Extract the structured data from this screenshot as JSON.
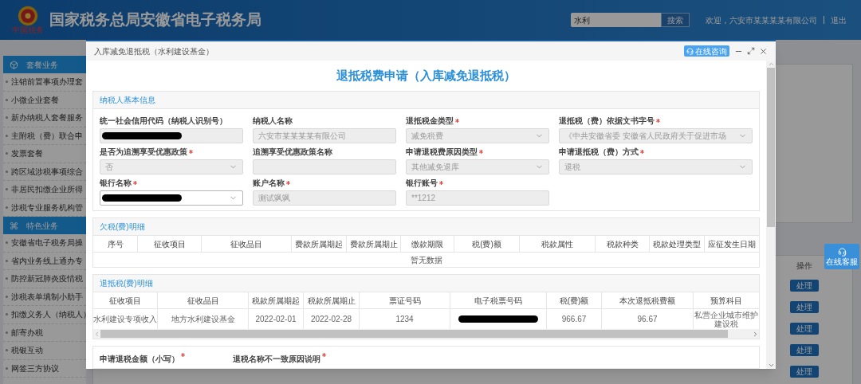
{
  "header": {
    "title": "国家税务总局安徽省电子税务局",
    "logo_text": "中国税务",
    "search": {
      "value": "水利"
    },
    "search_button": "搜索",
    "welcome": "欢迎，六安市某某某某有限公司",
    "logout": "退出"
  },
  "sidebar": [
    {
      "title": "套餐业务",
      "kind": "package",
      "items": [
        "注销前置事项办理套",
        "小微企业套餐",
        "新办纳税人套餐服务",
        "主附税（费）联合申",
        "发票套餐",
        "跨区域涉税事项综合",
        "非居民扣缴企业所得",
        "涉税专业服务机构管"
      ]
    },
    {
      "title": "特色业务",
      "kind": "feature",
      "items": [
        "安徽省电子税务局操",
        "省内业务线上通办专",
        "防控新冠肺炎疫情税",
        "涉税表单填制小助手",
        "扣缴义务人（纳税人）",
        "邮寄办税",
        "税银互动",
        "网签三方协议"
      ]
    }
  ],
  "background_table": {
    "column": "操作",
    "buttons": [
      "处理",
      "处理",
      "处理",
      "处理",
      "处理"
    ]
  },
  "float_service": "在线客服",
  "modal": {
    "title": "入库减免退抵税（水利建设基金）",
    "consult_button": "在线咨询",
    "heading": "退抵税费申请（入库减免退抵税）",
    "basic_info": {
      "title": "纳税人基本信息",
      "fields": [
        {
          "label": "统一社会信用代码（纳税人识别号）",
          "required": false,
          "kind": "input",
          "redacted": true,
          "disabled": true
        },
        {
          "label": "纳税人名称",
          "required": false,
          "kind": "input",
          "value": "六安市某某某某有限公司",
          "redacted": false,
          "disabled": true
        },
        {
          "label": "退抵税金类型",
          "required": true,
          "kind": "select",
          "value": "减免税费",
          "redacted": false,
          "disabled": true
        },
        {
          "label": "退抵税（费）依据文书字号",
          "required": true,
          "kind": "select",
          "value": "《中共安徽省委 安徽省人民政府关于促进市场",
          "redacted": false,
          "disabled": true
        },
        {
          "label": "是否为追溯享受优惠政策",
          "required": true,
          "kind": "select",
          "value": "否",
          "redacted": false,
          "disabled": true
        },
        {
          "label": "追溯享受优惠政策名称",
          "required": false,
          "kind": "input",
          "redacted": false,
          "disabled": true
        },
        {
          "label": "申请退税费原因类型",
          "required": true,
          "kind": "select",
          "value": "其他减免退库",
          "redacted": false,
          "disabled": true
        },
        {
          "label": "申请退抵税（费）方式",
          "required": true,
          "kind": "select",
          "value": "退税",
          "redacted": false,
          "disabled": true
        },
        {
          "label": "银行名称",
          "required": true,
          "kind": "select",
          "redacted": true,
          "disabled": false
        },
        {
          "label": "账户名称",
          "required": true,
          "kind": "input",
          "value": "测试飒飒",
          "redacted": false,
          "disabled": true
        },
        {
          "label": "银行账号",
          "required": true,
          "kind": "input",
          "value": "**1212",
          "redacted": false,
          "disabled": true
        }
      ]
    },
    "arrears": {
      "title": "欠税(费)明细",
      "columns": [
        "序号",
        "征收项目",
        "征收品目",
        "费款所属期起",
        "费款所属期止",
        "缴款期限",
        "税(费)额",
        "税款属性",
        "税款种类",
        "税款处理类型",
        "应征发生日期"
      ],
      "empty_text": "暂无数据"
    },
    "refund": {
      "title": "退抵税(费)明细",
      "columns": [
        "征收项目",
        "征收品目",
        "税款所属期起",
        "税款所属期止",
        "票证号码",
        "电子税票号码",
        "税(费)额",
        "本次退抵税费额",
        "预算科目"
      ],
      "rows": [
        [
          {
            "text": "水利建设专项收入",
            "redacted": false
          },
          {
            "text": "地方水利建设基金",
            "redacted": false
          },
          {
            "text": "2022-02-01",
            "redacted": false
          },
          {
            "text": "2022-02-28",
            "redacted": false
          },
          {
            "text": "1234",
            "redacted": false
          },
          {
            "redacted": true
          },
          {
            "text": "966.67",
            "redacted": false
          },
          {
            "text": "96.67",
            "redacted": false
          },
          {
            "text": "私营企业城市维护建设税",
            "redacted": false
          }
        ]
      ]
    },
    "bottom_fields": [
      {
        "label": "申请退税金额（小写）",
        "required": true
      },
      {
        "label": "退税名称不一致原因说明",
        "required": true
      }
    ]
  }
}
